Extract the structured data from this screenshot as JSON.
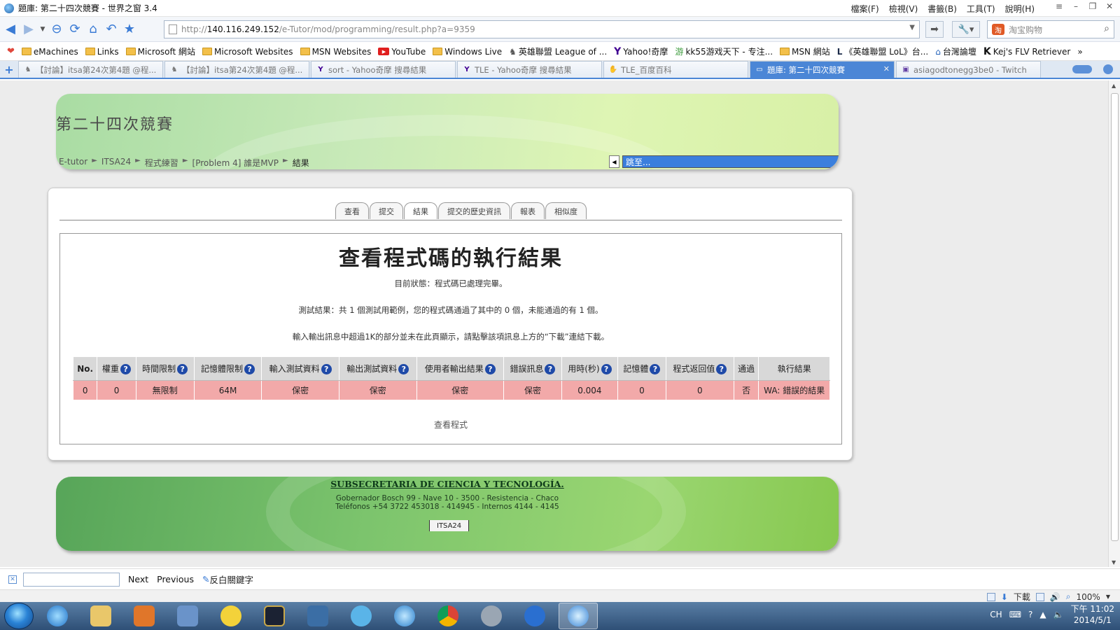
{
  "window": {
    "title": "題庫: 第二十四次競賽 - 世界之窗 3.4",
    "menus": [
      "檔案(F)",
      "檢視(V)",
      "書籤(B)",
      "工具(T)",
      "說明(H)"
    ]
  },
  "nav": {
    "url_prefix": "http://",
    "url_host": "140.116.249.152",
    "url_path": "/e-Tutor/mod/programming/result.php?a=9359",
    "search_placeholder": "淘宝购物"
  },
  "bookmarks": [
    "eMachines",
    "Links",
    "Microsoft 網站",
    "Microsoft Websites",
    "MSN Websites",
    "YouTube",
    "Windows Live",
    "英雄聯盟 League of ...",
    "Yahoo!奇摩",
    "kk55游戏天下 - 专注...",
    "MSN 網站",
    "《英雄聯盟 LoL》台...",
    "台灣論壇",
    "Kej's FLV Retriever"
  ],
  "tabs": [
    {
      "label": "【討論】itsa第24次第4題 @程..."
    },
    {
      "label": "【討論】itsa第24次第4題 @程..."
    },
    {
      "label": "sort - Yahoo奇摩 搜尋結果"
    },
    {
      "label": "TLE - Yahoo奇摩 搜尋結果"
    },
    {
      "label": "TLE_百度百科"
    },
    {
      "label": "題庫: 第二十四次競賽"
    },
    {
      "label": "asiagodtonegg3be0 - Twitch"
    }
  ],
  "header": {
    "site_title": "第二十四次競賽",
    "breadcrumb": [
      "E-tutor",
      "ITSA24",
      "程式練習",
      "[Problem 4] 誰是MVP",
      "結果"
    ],
    "jump_label": "跳至..."
  },
  "page_tabs": [
    "查看",
    "提交",
    "結果",
    "提交的歷史資訊",
    "報表",
    "相似度"
  ],
  "result": {
    "title": "查看程式碼的執行結果",
    "status_line": "目前狀態：程式碼已處理完畢。",
    "summary_line": "測試結果：共 1 個測試用範例，您的程式碼通過了其中的 0 個，未能通過的有 1 個。",
    "note_line": "輸入輸出訊息中超過1K的部分並未在此頁顯示，請點擊該項訊息上方的“下載”連結下載。",
    "columns": [
      "No.",
      "權重",
      "時間限制",
      "記憶體限制",
      "輸入測試資料",
      "輸出測試資料",
      "使用者輸出結果",
      "錯誤訊息",
      "用時(秒)",
      "記憶體",
      "程式返回值",
      "通過",
      "執行結果"
    ],
    "rows": [
      [
        "0",
        "0",
        "無限制",
        "64M",
        "保密",
        "保密",
        "保密",
        "保密",
        "0.004",
        "0",
        "0",
        "否",
        "WA: 錯誤的結果"
      ]
    ],
    "view_code": "查看程式"
  },
  "footer": {
    "org": "SUBSECRETARIA DE CIENCIA Y TECNOLOGÍA.",
    "address1": "Gobernador Bosch 99 - Nave 10 - 3500 - Resistencia - Chaco",
    "address2": "Teléfonos +54 3722 453018 - 414945 - Internos 4144 - 4145",
    "tab": "ITSA24"
  },
  "findbar": {
    "next": "Next",
    "previous": "Previous",
    "highlight": "反白關鍵字"
  },
  "statusbar": {
    "download": "下載",
    "zoom": "100%"
  },
  "taskbar": {
    "lang": "CH",
    "time": "下午 11:02",
    "date": "2014/5/1"
  }
}
